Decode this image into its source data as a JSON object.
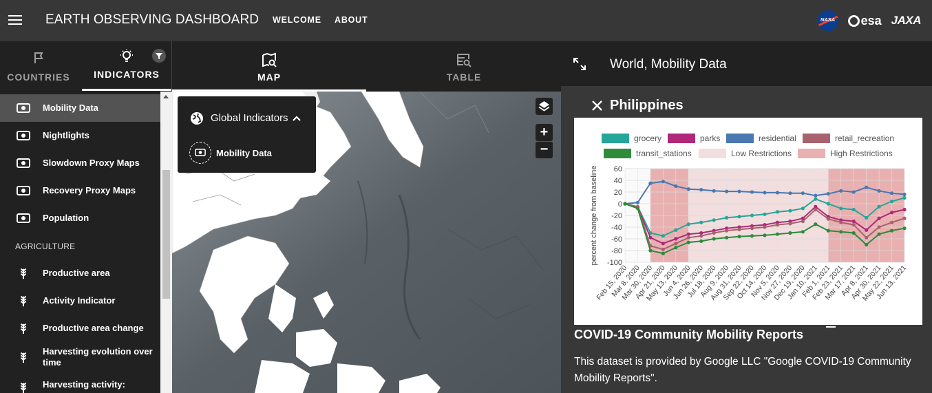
{
  "header": {
    "title": "EARTH OBSERVING DASHBOARD",
    "nav": [
      "WELCOME",
      "ABOUT"
    ],
    "logos": {
      "nasa": "NASA",
      "esa": "esa",
      "jaxa": "JAXA"
    }
  },
  "left_tabs": [
    {
      "label": "COUNTRIES",
      "icon": "flag-icon",
      "active": false
    },
    {
      "label": "INDICATORS",
      "icon": "lightbulb-icon",
      "active": true
    }
  ],
  "center_tabs": [
    {
      "label": "MAP",
      "icon": "map-search-icon",
      "active": true
    },
    {
      "label": "TABLE",
      "icon": "table-search-icon",
      "active": false
    }
  ],
  "sidebar": {
    "items": [
      {
        "label": "Mobility Data",
        "active": true
      },
      {
        "label": "Nightlights"
      },
      {
        "label": "Slowdown Proxy Maps"
      },
      {
        "label": "Recovery Proxy Maps"
      },
      {
        "label": "Population"
      }
    ],
    "section": "AGRICULTURE",
    "agri_items": [
      {
        "label": "Productive area"
      },
      {
        "label": "Activity Indicator"
      },
      {
        "label": "Productive area change"
      },
      {
        "label": "Harvesting evolution over time"
      },
      {
        "label": "Harvesting activity:"
      }
    ]
  },
  "map": {
    "panel_title": "Global Indicators",
    "panel_item": "Mobility Data",
    "zoom_in": "+",
    "zoom_out": "−"
  },
  "right_panel": {
    "title": "World, Mobility Data",
    "subtitle": "Philippines",
    "desc_title": "COVID-19 Community Mobility Reports",
    "desc_text": "This dataset is provided by Google LLC \"Google COVID-19 Community Mobility Reports\"."
  },
  "colors": {
    "grocery": "#26a69a",
    "parks": "#b0287a",
    "residential": "#4a78b0",
    "retail_recreation": "#a8626e",
    "transit_stations": "#2e8b3a",
    "low_restrictions": "#f2dede",
    "high_restrictions": "#e8b0b0"
  },
  "chart_data": {
    "type": "line",
    "ylabel": "percent change from baseline",
    "ylim": [
      -100,
      60
    ],
    "yticks": [
      60,
      40,
      20,
      0,
      -20,
      -40,
      -60,
      -80,
      -100
    ],
    "xticks": [
      "Feb 15, 2020",
      "Mar 8, 2020",
      "Mar 30, 2020",
      "Apr 21, 2020",
      "May 13, 2020",
      "Jun 4, 2020",
      "Jun 26, 2020",
      "Jul 18, 2020",
      "Aug 9, 2020",
      "Aug 31, 2020",
      "Sep 22, 2020",
      "Oct 14, 2020",
      "Nov 5, 2020",
      "Nov 27, 2020",
      "Dec 19, 2020",
      "Jan 10, 2021",
      "Feb 1, 2021",
      "Feb 23, 2021",
      "Mar 17, 2021",
      "Apr 8, 2021",
      "Apr 30, 2021",
      "May 22, 2021",
      "Jun 13, 2021"
    ],
    "legend": [
      "grocery",
      "parks",
      "residential",
      "retail_recreation",
      "transit_stations",
      "Low Restrictions",
      "High Restrictions"
    ],
    "series": [
      {
        "name": "residential",
        "values": [
          0,
          2,
          35,
          38,
          30,
          25,
          24,
          22,
          21,
          21,
          20,
          19,
          19,
          18,
          18,
          14,
          17,
          22,
          20,
          28,
          22,
          18,
          16
        ]
      },
      {
        "name": "grocery",
        "values": [
          0,
          -5,
          -50,
          -55,
          -45,
          -35,
          -32,
          -28,
          -24,
          -22,
          -20,
          -18,
          -14,
          -12,
          -8,
          8,
          0,
          -8,
          -10,
          -24,
          -5,
          4,
          10
        ]
      },
      {
        "name": "parks",
        "values": [
          0,
          -6,
          -58,
          -68,
          -60,
          -52,
          -50,
          -46,
          -42,
          -40,
          -38,
          -36,
          -32,
          -30,
          -25,
          -5,
          -22,
          -28,
          -30,
          -45,
          -25,
          -15,
          -10
        ]
      },
      {
        "name": "retail_recreation",
        "values": [
          0,
          -6,
          -72,
          -78,
          -68,
          -58,
          -55,
          -50,
          -46,
          -44,
          -42,
          -40,
          -36,
          -34,
          -30,
          -10,
          -26,
          -32,
          -36,
          -58,
          -40,
          -32,
          -25
        ]
      },
      {
        "name": "transit_stations",
        "values": [
          0,
          -8,
          -80,
          -85,
          -75,
          -66,
          -64,
          -60,
          -58,
          -56,
          -55,
          -54,
          -52,
          -50,
          -48,
          -35,
          -46,
          -48,
          -50,
          -70,
          -52,
          -46,
          -42
        ]
      }
    ],
    "restriction_bands": [
      {
        "label": "High Restrictions",
        "from_index": 2,
        "to_index": 5
      },
      {
        "label": "Low Restrictions",
        "from_index": 5,
        "to_index": 16
      },
      {
        "label": "High Restrictions",
        "from_index": 16,
        "to_index": 22
      }
    ]
  }
}
